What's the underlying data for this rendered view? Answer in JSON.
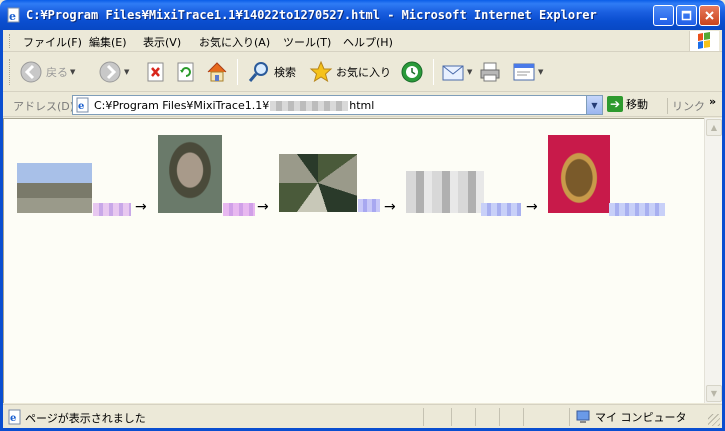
{
  "window": {
    "title": "C:¥Program Files¥MixiTrace1.1¥14022to1270527.html - Microsoft Internet Explorer",
    "title_color": "#ffffff",
    "frame_color": "#0a4ed0"
  },
  "menu": {
    "items": [
      {
        "label": "ファイル(F)"
      },
      {
        "label": "編集(E)"
      },
      {
        "label": "表示(V)"
      },
      {
        "label": "お気に入り(A)"
      },
      {
        "label": "ツール(T)"
      },
      {
        "label": "ヘルプ(H)"
      }
    ]
  },
  "toolbar": {
    "back_label": "戻る",
    "search_label": "検索",
    "favorites_label": "お気に入り"
  },
  "address": {
    "label": "アドレス(D)",
    "value_prefix": "C:¥Program Files¥MixiTrace1.1¥",
    "value_suffix": "html",
    "go_label": "移動",
    "links_label": "リンク",
    "more": "»"
  },
  "content": {
    "background": "#fdfdf6",
    "arrow": "→"
  },
  "status": {
    "text": "ページが表示されました",
    "zone": "マイ コンピュータ"
  }
}
